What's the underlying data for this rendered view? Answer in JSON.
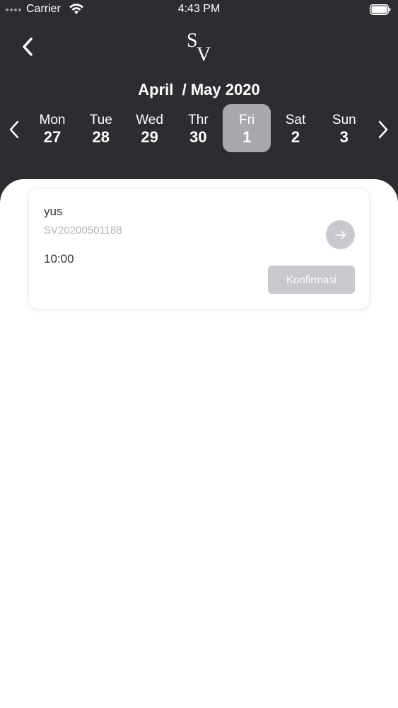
{
  "status_bar": {
    "carrier": "Carrier",
    "time": "4:43 PM"
  },
  "header": {
    "logo_text": "SV",
    "month_label": "April  / May 2020",
    "days": [
      {
        "name": "Mon",
        "num": "27"
      },
      {
        "name": "Tue",
        "num": "28"
      },
      {
        "name": "Wed",
        "num": "29"
      },
      {
        "name": "Thr",
        "num": "30"
      },
      {
        "name": "Fri",
        "num": "1"
      },
      {
        "name": "Sat",
        "num": "2"
      },
      {
        "name": "Sun",
        "num": "3"
      }
    ],
    "selected_day_index": 4
  },
  "booking": {
    "name": "yus",
    "code": "SV20200501188",
    "time": "10:00",
    "confirm_label": "Konfirmasi"
  },
  "colors": {
    "header_bg": "#2d2d31",
    "selected_day": "#a9a9ad",
    "button_bg": "#c9c8cf"
  },
  "icons": [
    "back-chevron-icon",
    "wifi-icon",
    "battery-icon",
    "chevron-left-icon",
    "chevron-right-icon",
    "arrow-right-icon"
  ]
}
